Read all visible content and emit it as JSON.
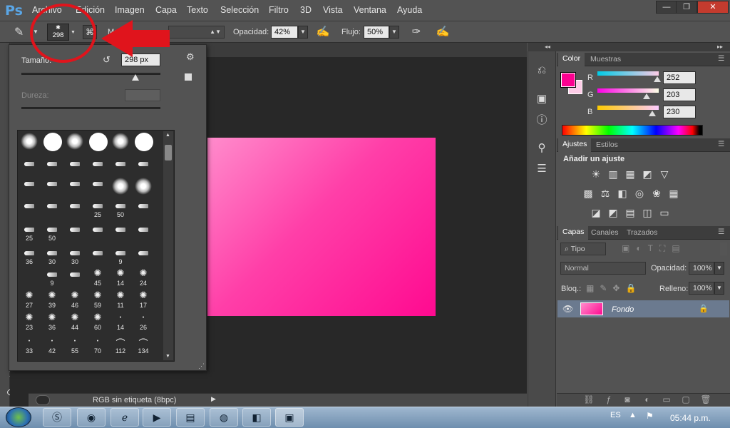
{
  "app": {
    "logo": "Ps"
  },
  "menu": [
    "Archivo",
    "Edición",
    "Imagen",
    "Capa",
    "Texto",
    "Selección",
    "Filtro",
    "3D",
    "Vista",
    "Ventana",
    "Ayuda"
  ],
  "window_controls": {
    "minimize": "—",
    "restore": "❐",
    "close": "✕"
  },
  "options": {
    "brush_size": "298",
    "mode_label": "Mod",
    "opacity_label": "Opacidad:",
    "opacity_value": "42%",
    "flow_label": "Flujo:",
    "flow_value": "50%"
  },
  "brush_picker": {
    "size_label": "Tamaño:",
    "size_value": "298 px",
    "hardness_label": "Dureza:",
    "size_slider_fraction": 0.82,
    "rows": [
      [
        {
          "k": "soft"
        },
        {
          "k": "hard"
        },
        {
          "k": "soft"
        },
        {
          "k": "hard"
        },
        {
          "k": "soft"
        },
        {
          "k": "hard"
        }
      ],
      [
        {
          "k": "stroke"
        },
        {
          "k": "stroke"
        },
        {
          "k": "stroke"
        },
        {
          "k": "stroke"
        },
        {
          "k": "stroke"
        },
        {
          "k": "stroke"
        }
      ],
      [
        {
          "k": "stroke"
        },
        {
          "k": "stroke"
        },
        {
          "k": "stroke"
        },
        {
          "k": "stroke"
        },
        {
          "k": "soft"
        },
        {
          "k": "soft"
        }
      ],
      [
        {
          "k": "stroke"
        },
        {
          "k": "stroke"
        },
        {
          "k": "stroke"
        },
        {
          "k": "stroke",
          "l": "25"
        },
        {
          "k": "stroke",
          "l": "50"
        },
        {
          "k": "stroke"
        }
      ],
      [
        {
          "k": "stroke",
          "l": "25"
        },
        {
          "k": "stroke",
          "l": "50"
        },
        {
          "k": "stroke"
        },
        {
          "k": "stroke"
        },
        {
          "k": "stroke"
        },
        {
          "k": "stroke"
        }
      ],
      [
        {
          "k": "stroke",
          "l": "36"
        },
        {
          "k": "stroke",
          "l": "30"
        },
        {
          "k": "stroke",
          "l": "30"
        },
        {
          "k": "stroke"
        },
        {
          "k": "stroke",
          "l": "9"
        },
        {
          "k": "stroke"
        }
      ],
      [
        {
          "k": "blank"
        },
        {
          "k": "stroke",
          "l": "9"
        },
        {
          "k": "stroke"
        },
        {
          "k": "splat",
          "l": "45"
        },
        {
          "k": "splat",
          "l": "14"
        },
        {
          "k": "splat",
          "l": "24"
        }
      ],
      [
        {
          "k": "splat",
          "l": "27"
        },
        {
          "k": "splat",
          "l": "39"
        },
        {
          "k": "splat",
          "l": "46"
        },
        {
          "k": "splat",
          "l": "59"
        },
        {
          "k": "splat",
          "l": "11"
        },
        {
          "k": "splat",
          "l": "17"
        }
      ],
      [
        {
          "k": "splat",
          "l": "23"
        },
        {
          "k": "splat",
          "l": "36"
        },
        {
          "k": "splat",
          "l": "44"
        },
        {
          "k": "splat",
          "l": "60"
        },
        {
          "k": "dot",
          "l": "14"
        },
        {
          "k": "dot",
          "l": "26"
        }
      ],
      [
        {
          "k": "dot",
          "l": "33"
        },
        {
          "k": "dot",
          "l": "42"
        },
        {
          "k": "dot",
          "l": "55"
        },
        {
          "k": "dot",
          "l": "70"
        },
        {
          "k": "curve",
          "l": "112"
        },
        {
          "k": "curve",
          "l": "134"
        }
      ]
    ]
  },
  "status": {
    "text": "RGB sin etiqueta (8bpc)"
  },
  "color_panel": {
    "tabs": [
      "Color",
      "Muestras"
    ],
    "foreground": "#fc0090",
    "background": "#fccbe6",
    "channels": [
      {
        "label": "R",
        "value": "252",
        "fraction": 0.98,
        "grad": "linear-gradient(90deg,#00cbe6,#fccbe6)"
      },
      {
        "label": "G",
        "value": "203",
        "fraction": 0.8,
        "grad": "linear-gradient(90deg,#fc00e6,#fcffe6)"
      },
      {
        "label": "B",
        "value": "230",
        "fraction": 0.9,
        "grad": "linear-gradient(90deg,#fccb00,#fccbff)"
      }
    ]
  },
  "adjustments_panel": {
    "tabs": [
      "Ajustes",
      "Estilos"
    ],
    "heading": "Añadir un ajuste",
    "rows": [
      [
        "☀",
        "▥",
        "▦",
        "◩",
        "▽"
      ],
      [
        "▩",
        "⚖",
        "◧",
        "◎",
        "❀",
        "▦"
      ],
      [
        "◪",
        "◩",
        "▤",
        "◫",
        "▭"
      ]
    ]
  },
  "layers_panel": {
    "tabs": [
      "Capas",
      "Canales",
      "Trazados"
    ],
    "filter": "Tipo",
    "blend_mode": "Normal",
    "opacity_label": "Opacidad:",
    "opacity_value": "100%",
    "lock_label": "Bloq.:",
    "fill_label": "Relleno:",
    "fill_value": "100%",
    "layer_name": "Fondo"
  },
  "taskbar": {
    "lang": "ES",
    "time": "05:44 p.m."
  }
}
